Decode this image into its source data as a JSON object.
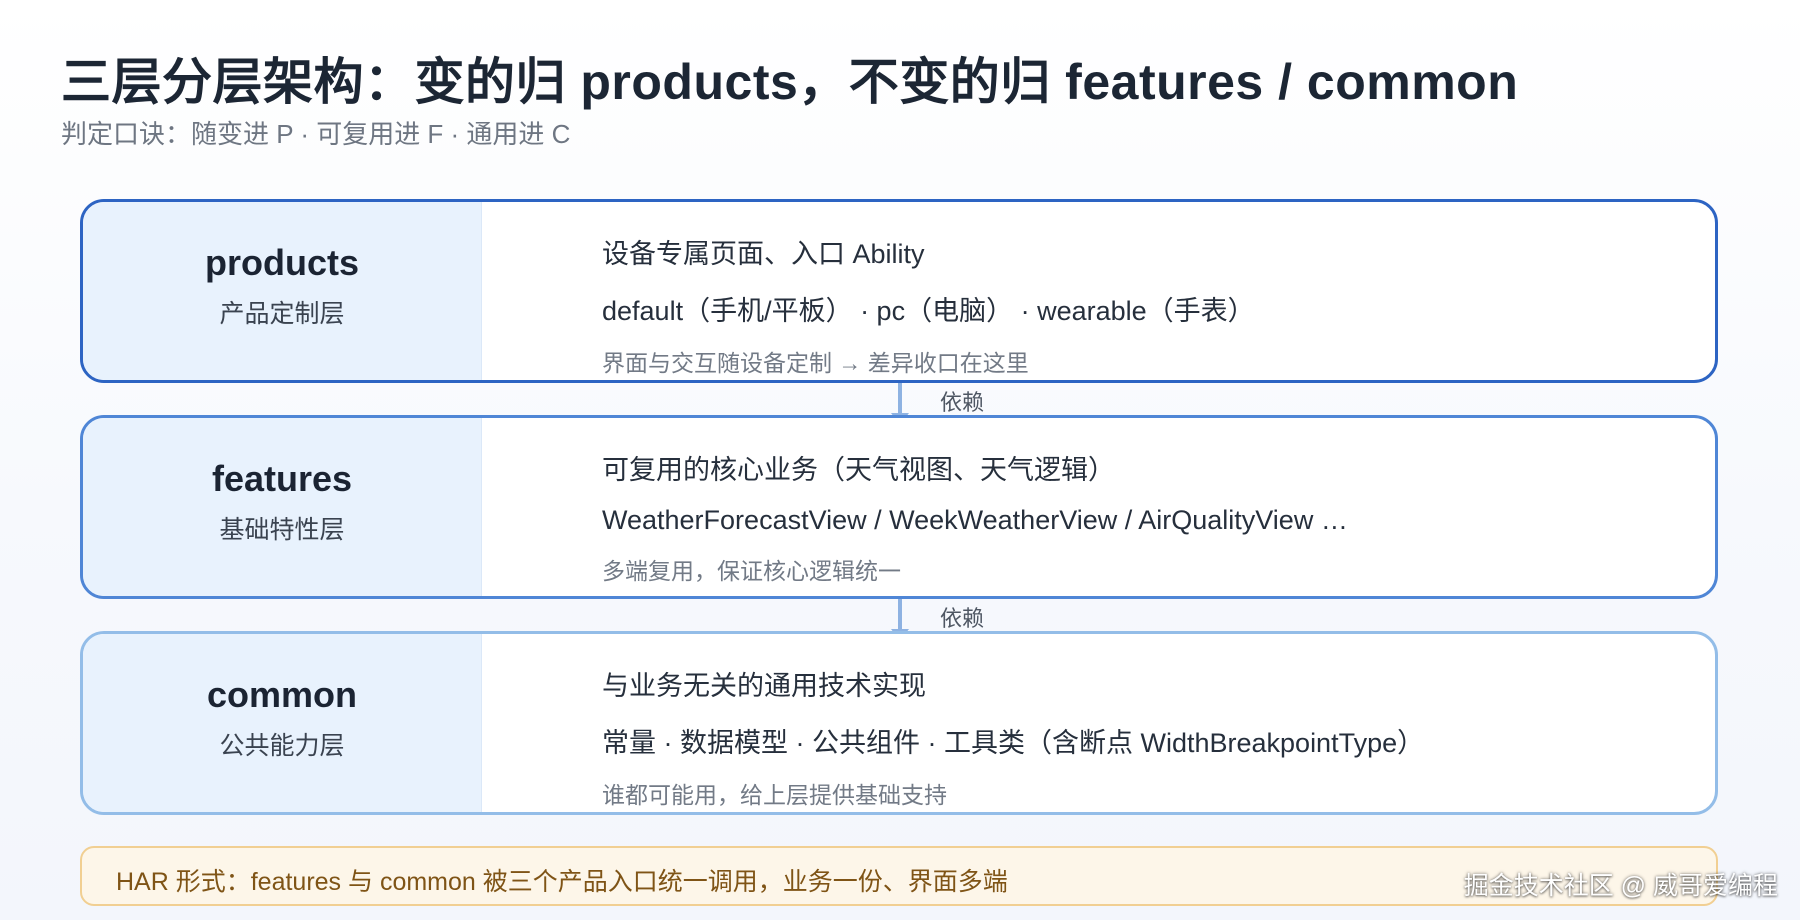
{
  "title": "三层分层架构：变的归 products，不变的归 features / common",
  "subtitle": "判定口诀：随变进 P · 可复用进 F · 通用进 C",
  "layers": [
    {
      "name": "products",
      "cn_name": "产品定制层",
      "line1": "设备专属页面、入口 Ability",
      "line2": "default（手机/平板） · pc（电脑） · wearable（手表）",
      "line3": "界面与交互随设备定制 → 差异收口在这里"
    },
    {
      "name": "features",
      "cn_name": "基础特性层",
      "line1": "可复用的核心业务（天气视图、天气逻辑）",
      "line2": "WeatherForecastView / WeekWeatherView / AirQualityView …",
      "line3": "多端复用，保证核心逻辑统一"
    },
    {
      "name": "common",
      "cn_name": "公共能力层",
      "line1": "与业务无关的通用技术实现",
      "line2": "常量 · 数据模型 · 公共组件 · 工具类（含断点 WidthBreakpointType）",
      "line3": "谁都可能用，给上层提供基础支持"
    }
  ],
  "dependency_label": "依赖",
  "note": "HAR 形式：features 与 common 被三个产品入口统一调用，业务一份、界面多端",
  "watermark": "掘金技术社区 @ 威哥爱编程",
  "colors": {
    "layer1_border": "#2d64c3",
    "layer2_border": "#4f86d6",
    "layer3_border": "#93bde8",
    "left_panel_bg": "#e8f2fd",
    "note_bg": "#fdf6e9",
    "note_border": "#f1cf92"
  }
}
